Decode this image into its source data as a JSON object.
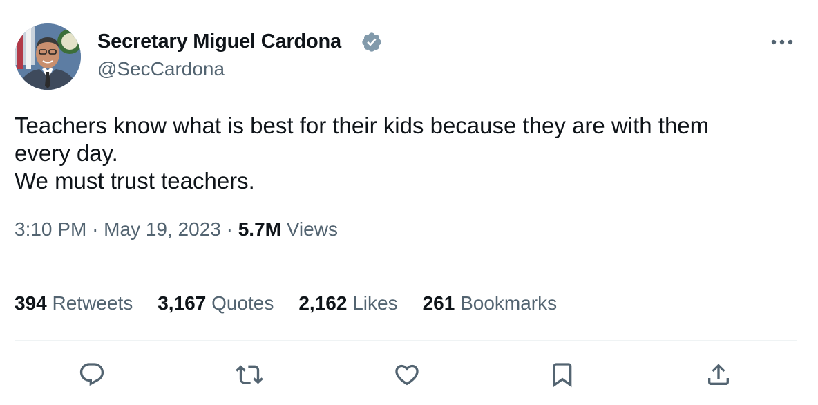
{
  "author": {
    "display_name": "Secretary Miguel Cardona",
    "handle": "@SecCardona",
    "verified": true
  },
  "tweet": {
    "text": "Teachers know what is best for their kids because they are with them\nevery day.\nWe must trust teachers."
  },
  "meta": {
    "time": "3:10 PM",
    "sep1": "·",
    "date": "May 19, 2023",
    "sep2": "·",
    "views_count": "5.7M",
    "views_label": "Views"
  },
  "stats": {
    "retweets": {
      "count": "394",
      "label": "Retweets"
    },
    "quotes": {
      "count": "3,167",
      "label": "Quotes"
    },
    "likes": {
      "count": "2,162",
      "label": "Likes"
    },
    "bookmarks": {
      "count": "261",
      "label": "Bookmarks"
    }
  },
  "icons": {
    "more": "more-dots-icon",
    "reply": "reply-icon",
    "retweet": "retweet-icon",
    "like": "heart-icon",
    "bookmark": "bookmark-icon",
    "share": "share-icon",
    "verified": "verified-badge-icon"
  },
  "colors": {
    "text": "#0f1419",
    "secondary": "#536471",
    "divider": "#eff3f4",
    "verified_badge": "#829aab"
  }
}
